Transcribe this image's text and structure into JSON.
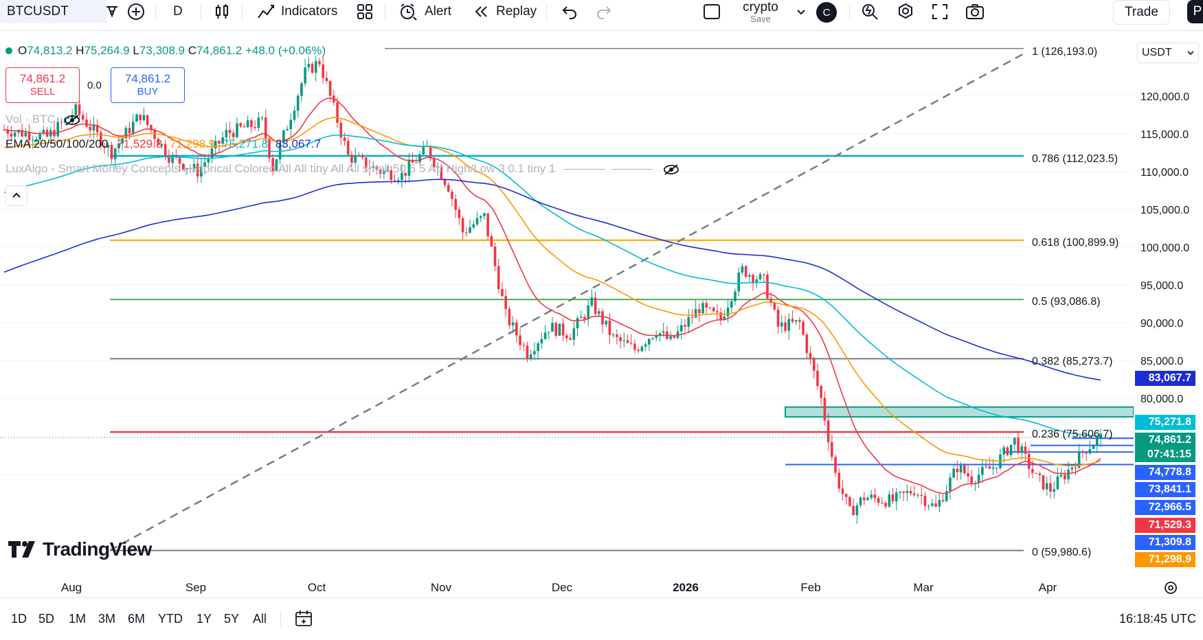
{
  "toolbar": {
    "symbol": "BTCUSDT",
    "interval": "D",
    "indicators_label": "Indicators",
    "alert_label": "Alert",
    "replay_label": "Replay",
    "layout_name": "crypto",
    "save_label": "Save",
    "avatar_letter": "C",
    "trade_label": "Trade",
    "publish_letter": "P"
  },
  "legend": {
    "ohlc": {
      "o_label": "O",
      "o": "74,813.2",
      "h_label": "H",
      "h": "75,264.9",
      "l_label": "L",
      "l": "73,308.9",
      "c_label": "C",
      "c": "74,861.2",
      "change": "+48.0 (+0.06%)"
    },
    "sell_price": "74,861.2",
    "sell_label": "SELL",
    "spread": "0.0",
    "buy_price": "74,861.2",
    "buy_label": "BUY",
    "vol_label": "Vol · BTC",
    "ema_label": "EMA 20/50/100/200",
    "ema20": "71,529.3",
    "ema50": "71,298.9",
    "ema100": "75,271.8",
    "ema200": "83,067.7",
    "luxalgo_label": "LuxAlgo - Smart Money Concepts Historical Colored All All tiny All All small 50 5 5 Atr High/Low 3 0.1 tiny 1"
  },
  "currency": "USDT",
  "price_ticks": [
    "120,000.0",
    "115,000.0",
    "110,000.0",
    "105,000.0",
    "100,000.0",
    "95,000.0",
    "90,000.0",
    "85,000.0",
    "80,000.0"
  ],
  "price_labels": [
    {
      "text": "83,067.7",
      "color": "#1d2dd6"
    },
    {
      "text": "75,271.8",
      "color": "#00bcd4"
    },
    {
      "text": "74,861.2",
      "color": "#089981"
    },
    {
      "text": "07:41:15",
      "color": "#089981"
    },
    {
      "text": "74,778.8",
      "color": "#2962ff"
    },
    {
      "text": "73,841.1",
      "color": "#2962ff"
    },
    {
      "text": "72,966.5",
      "color": "#2962ff"
    },
    {
      "text": "71,529.3",
      "color": "#f23645"
    },
    {
      "text": "71,309.8",
      "color": "#2962ff"
    },
    {
      "text": "71,298.9",
      "color": "#ff9800"
    }
  ],
  "fib_levels": [
    {
      "label": "1 (126,193.0)",
      "color": "#787b86"
    },
    {
      "label": "0.786 (112,023.5)",
      "color": "#00acc1"
    },
    {
      "label": "0.618 (100,899.9)",
      "color": "#f2b51d"
    },
    {
      "label": "0.5 (93,086.8)",
      "color": "#4caf50"
    },
    {
      "label": "0.382 (85,273.7)",
      "color": "#787b86"
    },
    {
      "label": "0.236 (75,606.7)",
      "color": "#f23645"
    },
    {
      "label": "0 (59,980.6)",
      "color": "#787b86"
    }
  ],
  "time_labels": [
    "Aug",
    "Sep",
    "Oct",
    "Nov",
    "Dec",
    "2026",
    "Feb",
    "Mar",
    "Apr"
  ],
  "ranges": [
    "1D",
    "5D",
    "1M",
    "3M",
    "6M",
    "YTD",
    "1Y",
    "5Y",
    "All"
  ],
  "clock": "16:18:45 UTC",
  "watermark": "TradingView",
  "colors": {
    "up": "#089981",
    "down": "#f23645"
  }
}
